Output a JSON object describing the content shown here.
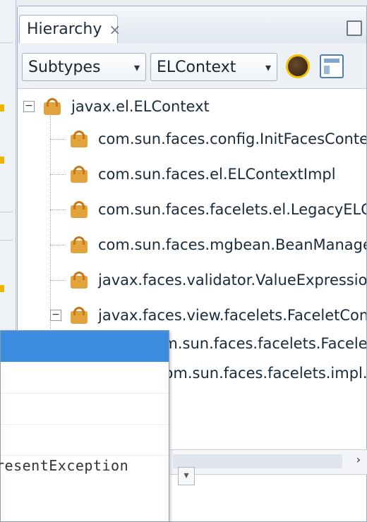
{
  "window": {
    "tab_title": "Hierarchy",
    "tab_close_glyph": "×"
  },
  "toolbar": {
    "type_combo": "Subtypes",
    "class_combo": "ELContext",
    "combo_arrow": "▾",
    "icons": [
      "coffee-bean-icon",
      "view-layout-icon"
    ]
  },
  "tree": {
    "root": "javax.el.ELContext",
    "children": [
      "com.sun.faces.config.InitFacesContext",
      "com.sun.faces.el.ELContextImpl",
      "com.sun.faces.facelets.el.LegacyELContext",
      "com.sun.faces.mgbean.BeanManager...",
      "javax.faces.validator.ValueExpression...",
      "javax.faces.view.facelets.FaceletContext"
    ],
    "grandchildren": [
      "com.sun.faces.facelets.FaceletContext...",
      "com.sun.faces.facelets.impl.D..."
    ],
    "expanded_glyph": "−"
  },
  "popup": {
    "text": "resentException",
    "caret": "▾"
  },
  "colors": {
    "selection_blue": "#3c8de0",
    "class_icon": "#e2a23c",
    "panel_border": "#9fb0c2"
  }
}
